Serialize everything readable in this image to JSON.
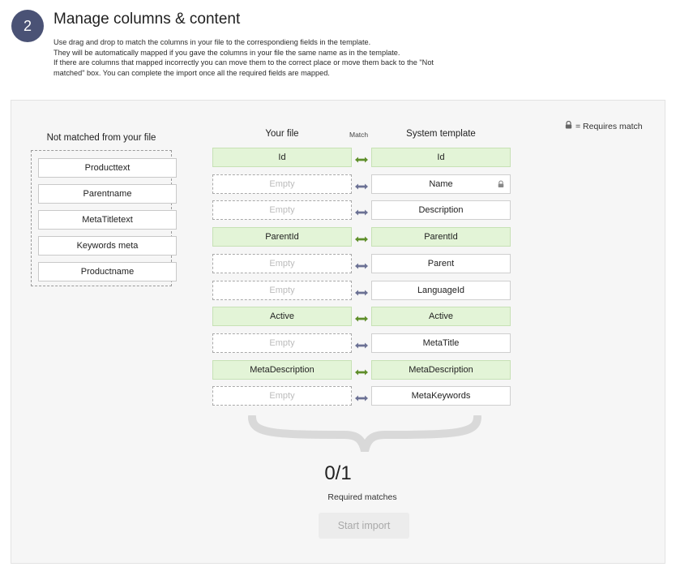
{
  "step": {
    "number": "2",
    "title": "Manage columns & content",
    "description": [
      "Use drag and drop to match the columns in your file to the correspondieng fields in the template.",
      "They will be automatically mapped if you gave the columns in your file the same name as in the template.",
      "If there are columns that mapped incorrectly you can move them to the correct place or move them back to the \"Not",
      "matched\" box. You can complete the import once all the required fields are mapped."
    ]
  },
  "legend": {
    "text": "= Requires match",
    "icon": "lock-icon"
  },
  "not_matched": {
    "title": "Not matched from your file",
    "items": [
      "Producttext",
      "Parentname",
      "MetaTitletext",
      "Keywords meta",
      "Productname"
    ]
  },
  "columns": {
    "your_file": "Your file",
    "match": "Match",
    "system_template": "System template"
  },
  "rows": [
    {
      "file": "Id",
      "template": "Id",
      "matched": true,
      "required": false
    },
    {
      "file": "Empty",
      "template": "Name",
      "matched": false,
      "required": true
    },
    {
      "file": "Empty",
      "template": "Description",
      "matched": false,
      "required": false
    },
    {
      "file": "ParentId",
      "template": "ParentId",
      "matched": true,
      "required": false
    },
    {
      "file": "Empty",
      "template": "Parent",
      "matched": false,
      "required": false
    },
    {
      "file": "Empty",
      "template": "LanguageId",
      "matched": false,
      "required": false
    },
    {
      "file": "Active",
      "template": "Active",
      "matched": true,
      "required": false
    },
    {
      "file": "Empty",
      "template": "MetaTitle",
      "matched": false,
      "required": false
    },
    {
      "file": "MetaDescription",
      "template": "MetaDescription",
      "matched": true,
      "required": false
    },
    {
      "file": "Empty",
      "template": "MetaKeywords",
      "matched": false,
      "required": false
    }
  ],
  "summary": {
    "count": "0/1",
    "label": "Required matches",
    "progress": 0,
    "start_button": "Start import"
  },
  "colors": {
    "matched_bg": "#e3f4d7",
    "matched_arrow": "#5f8e2a",
    "unmatched_arrow": "#6b7194",
    "step_circle": "#4a5275"
  }
}
